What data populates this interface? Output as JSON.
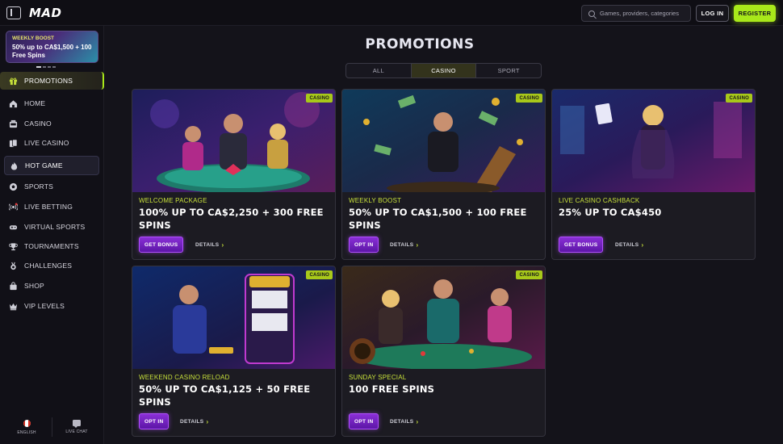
{
  "header": {
    "logo": "MAD",
    "search_placeholder": "Games, providers, categories",
    "login_label": "LOG IN",
    "register_label": "REGISTER"
  },
  "sidebar": {
    "boost": {
      "title": "WEEKLY BOOST",
      "text": "50% up to CA$1,500 + 100 Free Spins"
    },
    "items": [
      {
        "label": "PROMOTIONS",
        "icon": "gift-icon"
      },
      {
        "label": "HOME",
        "icon": "home-icon"
      },
      {
        "label": "CASINO",
        "icon": "casino-icon"
      },
      {
        "label": "LIVE CASINO",
        "icon": "cards-icon"
      },
      {
        "label": "HOT GAME",
        "icon": "flame-icon"
      },
      {
        "label": "SPORTS",
        "icon": "ball-icon"
      },
      {
        "label": "LIVE BETTING",
        "icon": "live-icon"
      },
      {
        "label": "VIRTUAL SPORTS",
        "icon": "gamepad-icon"
      },
      {
        "label": "TOURNAMENTS",
        "icon": "trophy-icon"
      },
      {
        "label": "CHALLENGES",
        "icon": "medal-icon"
      },
      {
        "label": "SHOP",
        "icon": "bag-icon"
      },
      {
        "label": "VIP LEVELS",
        "icon": "crown-icon"
      }
    ],
    "footer": {
      "language": "ENGLISH",
      "chat": "LIVE CHAT"
    }
  },
  "main": {
    "title": "PROMOTIONS",
    "tabs": [
      "ALL",
      "CASINO",
      "SPORT"
    ],
    "active_tab": "CASINO",
    "cards": [
      {
        "badge": "CASINO",
        "category": "WELCOME PACKAGE",
        "headline": "100% UP TO CA$2,250 + 300 FREE SPINS",
        "cta": "GET BONUS",
        "details": "DETAILS"
      },
      {
        "badge": "CASINO",
        "category": "WEEKLY BOOST",
        "headline": "50% UP TO CA$1,500 + 100 FREE SPINS",
        "cta": "OPT IN",
        "details": "DETAILS"
      },
      {
        "badge": "CASINO",
        "category": "LIVE CASINO CASHBACK",
        "headline": "25% UP TO CA$450",
        "cta": "GET BONUS",
        "details": "DETAILS"
      },
      {
        "badge": "CASINO",
        "category": "WEEKEND CASINO RELOAD",
        "headline": "50% UP TO CA$1,125 + 50 FREE SPINS",
        "cta": "OPT IN",
        "details": "DETAILS"
      },
      {
        "badge": "CASINO",
        "category": "SUNDAY SPECIAL",
        "headline": "100 FREE SPINS",
        "cta": "OPT IN",
        "details": "DETAILS"
      }
    ]
  },
  "colors": {
    "accent": "#a8e81a",
    "cta": "#8a2fd6",
    "background": "#14131a"
  }
}
